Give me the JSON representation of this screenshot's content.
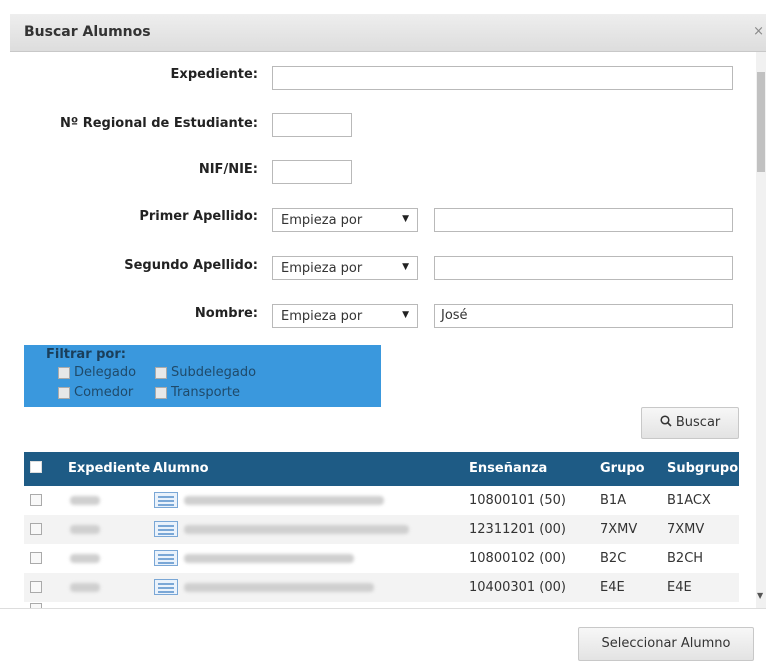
{
  "dialog": {
    "title": "Buscar Alumnos",
    "close_label": "×"
  },
  "form": {
    "expediente_label": "Expediente:",
    "regional_label": "Nº Regional de Estudiante:",
    "nif_label": "NIF/NIE:",
    "primer_apellido_label": "Primer Apellido:",
    "segundo_apellido_label": "Segundo Apellido:",
    "nombre_label": "Nombre:",
    "primer_apellido_mode": "Empieza por",
    "segundo_apellido_mode": "Empieza por",
    "nombre_mode": "Empieza por",
    "nombre_value": "José"
  },
  "filter": {
    "title": "Filtrar por:",
    "options": [
      "Delegado",
      "Subdelegado",
      "Comedor",
      "Transporte"
    ]
  },
  "search_button": {
    "label": "Buscar",
    "icon": "search-icon"
  },
  "table": {
    "columns": [
      "Expediente",
      "Alumno",
      "Enseñanza",
      "Grupo",
      "Subgrupo"
    ],
    "rows": [
      {
        "ensenanza": "10800101 (50)",
        "grupo": "B1A",
        "subgrupo": "B1ACX"
      },
      {
        "ensenanza": "12311201 (00)",
        "grupo": "7XMV",
        "subgrupo": "7XMV"
      },
      {
        "ensenanza": "10800102 (00)",
        "grupo": "B2C",
        "subgrupo": "B2CH"
      },
      {
        "ensenanza": "10400301 (00)",
        "grupo": "E4E",
        "subgrupo": "E4E"
      }
    ]
  },
  "footer": {
    "select_label": "Seleccionar Alumno"
  }
}
